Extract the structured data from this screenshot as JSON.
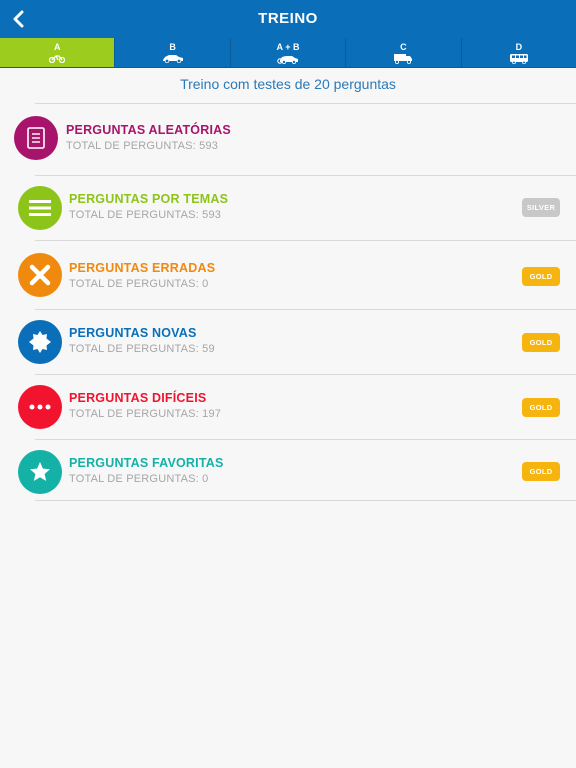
{
  "header": {
    "title": "TREINO",
    "back_icon": "chevron-left-icon",
    "background_color": "#0a6fb8"
  },
  "tabs": [
    {
      "label": "A",
      "icon": "motorcycle-icon",
      "active": true
    },
    {
      "label": "B",
      "icon": "car-icon",
      "active": false
    },
    {
      "label": "A + B",
      "icon": "car-motorcycle-icon",
      "active": false
    },
    {
      "label": "C",
      "icon": "truck-icon",
      "active": false
    },
    {
      "label": "D",
      "icon": "bus-icon",
      "active": false
    }
  ],
  "active_tab_color": "#9bcc1e",
  "subtitle": "Treino com testes de 20 perguntas",
  "categories": [
    {
      "title": "PERGUNTAS ALEATÓRIAS",
      "subtitle": "TOTAL DE PERGUNTAS: 593",
      "color": "#a8146b",
      "icon": "document-icon",
      "badge": ""
    },
    {
      "title": "PERGUNTAS POR TEMAS",
      "subtitle": "TOTAL DE PERGUNTAS: 593",
      "color": "#8dc41a",
      "icon": "list-icon",
      "badge": "SILVER",
      "badge_color": "#c8c8c8"
    },
    {
      "title": "PERGUNTAS ERRADAS",
      "subtitle": "TOTAL DE PERGUNTAS: 0",
      "color": "#f08a0e",
      "icon": "cross-icon",
      "badge": "GOLD",
      "badge_color": "#f6b40f"
    },
    {
      "title": "PERGUNTAS NOVAS",
      "subtitle": "TOTAL DE PERGUNTAS: 59",
      "color": "#0a6fb8",
      "icon": "badge-star-icon",
      "badge": "GOLD",
      "badge_color": "#f6b40f"
    },
    {
      "title": "PERGUNTAS DIFÍCEIS",
      "subtitle": "TOTAL DE PERGUNTAS: 197",
      "color": "#f2142f",
      "icon": "more-dots-icon",
      "badge": "GOLD",
      "badge_color": "#f6b40f"
    },
    {
      "title": "PERGUNTAS FAVORITAS",
      "subtitle": "TOTAL DE PERGUNTAS: 0",
      "color": "#14b2a6",
      "icon": "star-icon",
      "badge": "GOLD",
      "badge_color": "#f6b40f"
    }
  ]
}
